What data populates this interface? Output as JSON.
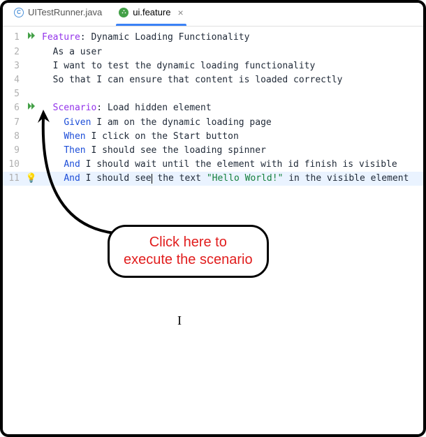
{
  "tabs": [
    {
      "label": "UITestRunner.java",
      "icon": "java",
      "active": false
    },
    {
      "label": "ui.feature",
      "icon": "cucumber",
      "active": true
    }
  ],
  "code": {
    "l1": {
      "kw": "Feature",
      "rest": ": Dynamic Loading Functionality"
    },
    "l2": "  As a user",
    "l3": "  I want to test the dynamic loading functionality",
    "l4": "  So that I can ensure that content is loaded correctly",
    "l5": "",
    "l6": {
      "kw": "Scenario",
      "rest": ": Load hidden element"
    },
    "l7": {
      "kw": "Given",
      "rest": " I am on the dynamic loading page"
    },
    "l8": {
      "kw": "When",
      "rest": " I click on the Start button"
    },
    "l9": {
      "kw": "Then",
      "rest": " I should see the loading spinner"
    },
    "l10": {
      "kw": "And",
      "rest": " I should wait until the element with id finish is visible"
    },
    "l11": {
      "kw": "And",
      "pre": " I should see",
      "post": " the text ",
      "str": "\"Hello World!\"",
      "tail": " in the visible element"
    }
  },
  "annotation": {
    "line1": "Click here to",
    "line2": "execute the scenario"
  }
}
